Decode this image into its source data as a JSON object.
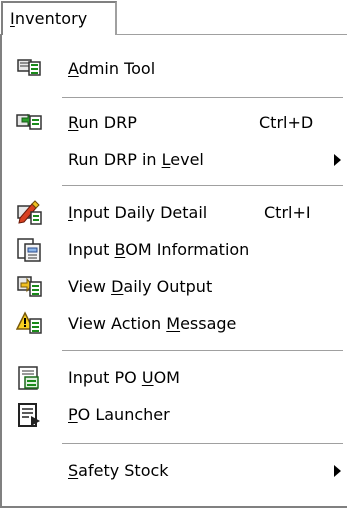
{
  "menubar": {
    "title": "Inventory"
  },
  "menu": {
    "items": [
      {
        "label": "Admin Tool",
        "mnemonic": "A",
        "icon": "admin-tool-icon",
        "shortcut": "",
        "submenu": false
      },
      {
        "label": "Run DRP",
        "mnemonic": "R",
        "icon": "run-drp-icon",
        "shortcut": "Ctrl+D",
        "submenu": false
      },
      {
        "label": "Run DRP in Level",
        "mnemonic": "L",
        "icon": "",
        "shortcut": "",
        "submenu": true
      },
      {
        "label": "Input Daily Detail",
        "mnemonic": "I",
        "icon": "input-daily-detail-icon",
        "shortcut": "Ctrl+I",
        "submenu": false
      },
      {
        "label": "Input BOM Information",
        "mnemonic": "B",
        "icon": "input-bom-icon",
        "shortcut": "",
        "submenu": false
      },
      {
        "label": "View Daily Output",
        "mnemonic": "D",
        "icon": "view-daily-output-icon",
        "shortcut": "",
        "submenu": false
      },
      {
        "label": "View Action Message",
        "mnemonic": "M",
        "icon": "view-action-message-icon",
        "shortcut": "",
        "submenu": false
      },
      {
        "label": "Input PO UOM",
        "mnemonic": "U",
        "icon": "input-po-uom-icon",
        "shortcut": "",
        "submenu": false
      },
      {
        "label": "PO Launcher",
        "mnemonic": "P",
        "icon": "po-launcher-icon",
        "shortcut": "",
        "submenu": false
      },
      {
        "label": "Safety Stock",
        "mnemonic": "S",
        "icon": "",
        "shortcut": "",
        "submenu": true
      }
    ]
  }
}
